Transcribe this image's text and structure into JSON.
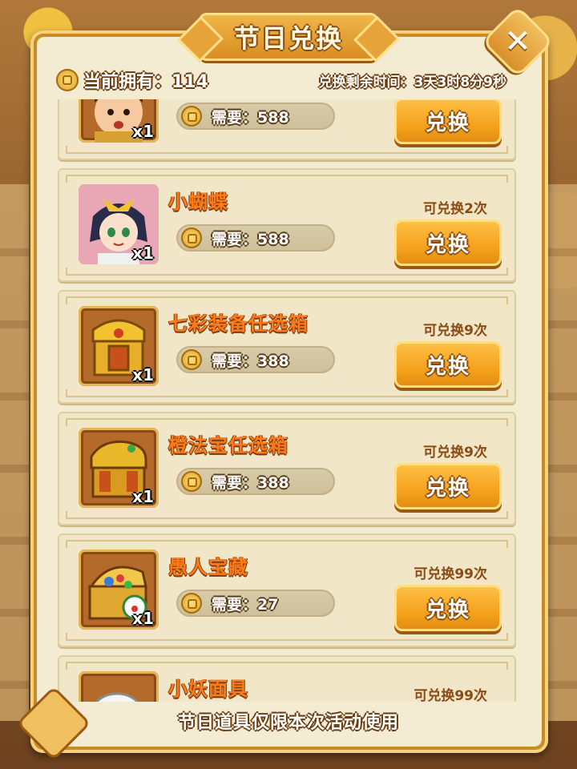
{
  "dialog": {
    "title": "节日兑换",
    "close_icon": "close-icon"
  },
  "header": {
    "owned_text": "当前拥有：114",
    "time_left_text": "兑换剩余时间：3天3时8分9秒"
  },
  "items": [
    {
      "name": "",
      "qty": "x1",
      "cost": "需要：588",
      "remaining": "",
      "button": "兑换",
      "icon": "hero-portrait-icon"
    },
    {
      "name": "小蝴蝶",
      "qty": "x1",
      "cost": "需要：588",
      "remaining": "可兑换2次",
      "button": "兑换",
      "icon": "butterfly-girl-portrait-icon"
    },
    {
      "name": "七彩装备任选箱",
      "qty": "x1",
      "cost": "需要：388",
      "remaining": "可兑换9次",
      "button": "兑换",
      "icon": "rainbow-equipment-chest-icon"
    },
    {
      "name": "橙法宝任选箱",
      "qty": "x1",
      "cost": "需要：388",
      "remaining": "可兑换9次",
      "button": "兑换",
      "icon": "orange-treasure-chest-icon"
    },
    {
      "name": "愚人宝藏",
      "qty": "x1",
      "cost": "需要：27",
      "remaining": "可兑换99次",
      "button": "兑换",
      "icon": "fool-treasure-chest-icon"
    },
    {
      "name": "小妖面具",
      "qty": "",
      "cost": "",
      "remaining": "可兑换99次",
      "button": "",
      "icon": "little-demon-mask-icon"
    }
  ],
  "footer": {
    "note": "节日道具仅限本次活动使用"
  },
  "colors": {
    "item_name": "#ff7a1a",
    "button": "#f5a21c",
    "panel": "#f3ebd2",
    "frame": "#e2b55c"
  }
}
